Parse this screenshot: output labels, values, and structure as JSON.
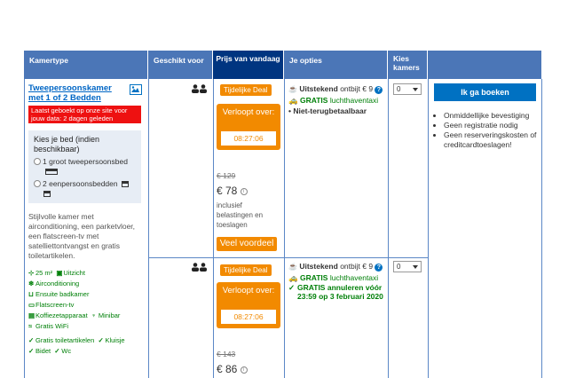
{
  "headers": {
    "kamertype": "Kamertype",
    "geschikt": "Geschikt voor",
    "prijs": "Prijs van vandaag",
    "opties": "Je opties",
    "kies": "Kies kamers"
  },
  "room": {
    "name": "Tweepersoonskamer met 1 of 2 Bedden",
    "last_booked": "Laatst geboekt op onze site voor jouw data: 2 dagen geleden",
    "bed_title": "Kies je bed (indien beschikbaar)",
    "bed_option_1": "1 groot tweepersoonsbed",
    "bed_option_2": "2 eenpersoonsbedden",
    "description": "Stijlvolle kamer met airconditioning, een parketvloer, een flatscreen-tv met satelliettontvangst en gratis toiletartikelen.",
    "features": {
      "size": "25 m²",
      "view": "Uitzicht",
      "ac": "Airconditioning",
      "bath": "Ensuite badkamer",
      "tv": "Flatscreen-tv",
      "coffee": "Koffiezetapparaat",
      "minibar": "Minibar",
      "wifi": "Gratis WiFi",
      "toiletries": "Gratis toiletartikelen",
      "wardrobe": "Kluisje",
      "bidet": "Bidet",
      "wc": "Wc"
    }
  },
  "offer1": {
    "deal_tag": "Tijdelijke Deal",
    "expires": "Verloopt over:",
    "timer": "08:27:06",
    "old_price": "€ 129",
    "price": "€ 78",
    "tax_note": "inclusief belastingen en toeslagen",
    "cta": "Veel voordeel",
    "breakfast_label": "Uitstekend",
    "breakfast_text": "ontbijt € 9",
    "taxi_label": "GRATIS",
    "taxi_text": "luchthaventaxi",
    "refund": "Niet-terugbetaalbaar",
    "select_value": "0"
  },
  "offer2": {
    "deal_tag": "Tijdelijke Deal",
    "expires": "Verloopt over:",
    "timer": "08:27:06",
    "old_price": "€ 143",
    "price": "€ 86",
    "breakfast_label": "Uitstekend",
    "breakfast_text": "ontbijt € 9",
    "taxi_label": "GRATIS",
    "taxi_text": "luchthaventaxi",
    "cancel": "GRATIS annuleren vóór 23:59 op 3 februari 2020",
    "select_value": "0"
  },
  "booking": {
    "button": "Ik ga boeken",
    "bullets": [
      "Onmiddellijke bevestiging",
      "Geen registratie nodig",
      "Geen reserveringskosten of creditcardtoeslagen!"
    ]
  },
  "colors": {
    "header": "#4b76b7",
    "header_dark": "#003580",
    "orange": "#f28a00",
    "blue_button": "#0071c2",
    "green": "#008009"
  }
}
